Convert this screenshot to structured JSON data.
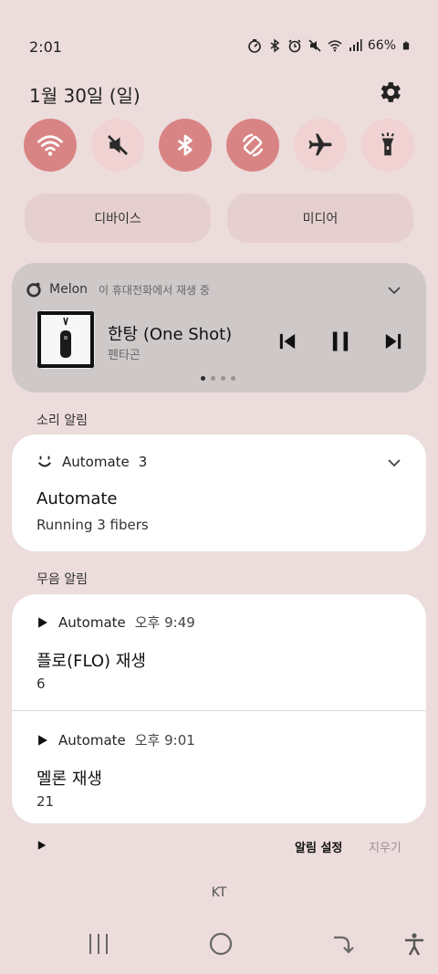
{
  "status": {
    "time": "2:01",
    "battery": "66%",
    "icons": [
      "timer-icon",
      "bluetooth-icon",
      "alarm-icon",
      "mute-icon",
      "wifi-icon",
      "signal-icon",
      "battery-icon"
    ]
  },
  "date": "1월 30일 (일)",
  "quick_settings": [
    {
      "name": "wifi",
      "on": true
    },
    {
      "name": "mute",
      "on": false
    },
    {
      "name": "bluetooth",
      "on": true
    },
    {
      "name": "auto-rotate",
      "on": true
    },
    {
      "name": "airplane",
      "on": false
    },
    {
      "name": "flashlight",
      "on": false
    }
  ],
  "pills": {
    "devices": "디바이스",
    "media": "미디어"
  },
  "media": {
    "app": "Melon",
    "subtitle": "이 휴대전화에서 재생 중",
    "title": "한탕 (One Shot)",
    "artist": "펜타곤",
    "page_count": 4,
    "page_index": 0
  },
  "sound_section": "소리 알림",
  "automate_card": {
    "app": "Automate",
    "count": "3",
    "title": "Automate",
    "body": "Running 3 fibers"
  },
  "silent_section": "무음 알림",
  "silent_notifications": [
    {
      "app": "Automate",
      "time": "오후 9:49",
      "title": "플로(FLO) 재생",
      "body": "6"
    },
    {
      "app": "Automate",
      "time": "오후 9:01",
      "title": "멜론 재생",
      "body": "21"
    }
  ],
  "footer": {
    "settings": "알림 설정",
    "clear": "지우기"
  },
  "carrier": "KT"
}
